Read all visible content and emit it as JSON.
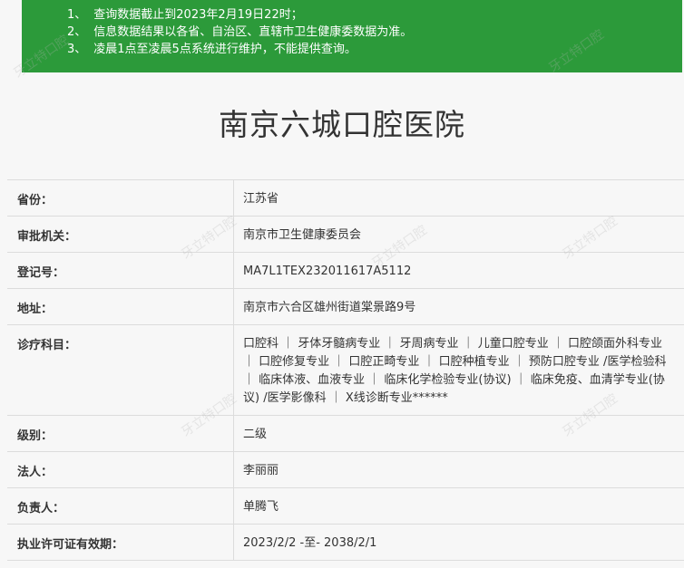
{
  "notice": {
    "lines": [
      {
        "num": "1、",
        "text": "查询数据截止到2023年2月19日22时；"
      },
      {
        "num": "2、",
        "text": "信息数据结果以各省、自治区、直辖市卫生健康委数据为准。"
      },
      {
        "num": "3、",
        "text": "凌晨1点至凌晨5点系统进行维护，不能提供查询。"
      }
    ]
  },
  "title": "南京六城口腔医院",
  "rows": [
    {
      "label": "省份：",
      "value": "江苏省"
    },
    {
      "label": "审批机关：",
      "value": "南京市卫生健康委员会"
    },
    {
      "label": "登记号：",
      "value": "MA7L1TEX232011617A5112"
    },
    {
      "label": "地址：",
      "value": "南京市六合区雄州街道棠景路9号"
    },
    {
      "label": "诊疗科目：",
      "value": "口腔科 ｜ 牙体牙髓病专业 ｜ 牙周病专业 ｜ 儿童口腔专业 ｜ 口腔颌面外科专业 ｜ 口腔修复专业 ｜ 口腔正畸专业 ｜ 口腔种植专业 ｜ 预防口腔专业 /医学检验科 ｜ 临床体液、血液专业 ｜ 临床化学检验专业(协议) ｜ 临床免疫、血清学专业(协议) /医学影像科 ｜ X线诊断专业******"
    },
    {
      "label": "级别：",
      "value": "二级"
    },
    {
      "label": "法人：",
      "value": "李丽丽"
    },
    {
      "label": "负责人：",
      "value": "单腾飞"
    },
    {
      "label": "执业许可证有效期：",
      "value": "2023/2/2 -至- 2038/2/1"
    }
  ],
  "watermark_text": "牙立特口腔"
}
